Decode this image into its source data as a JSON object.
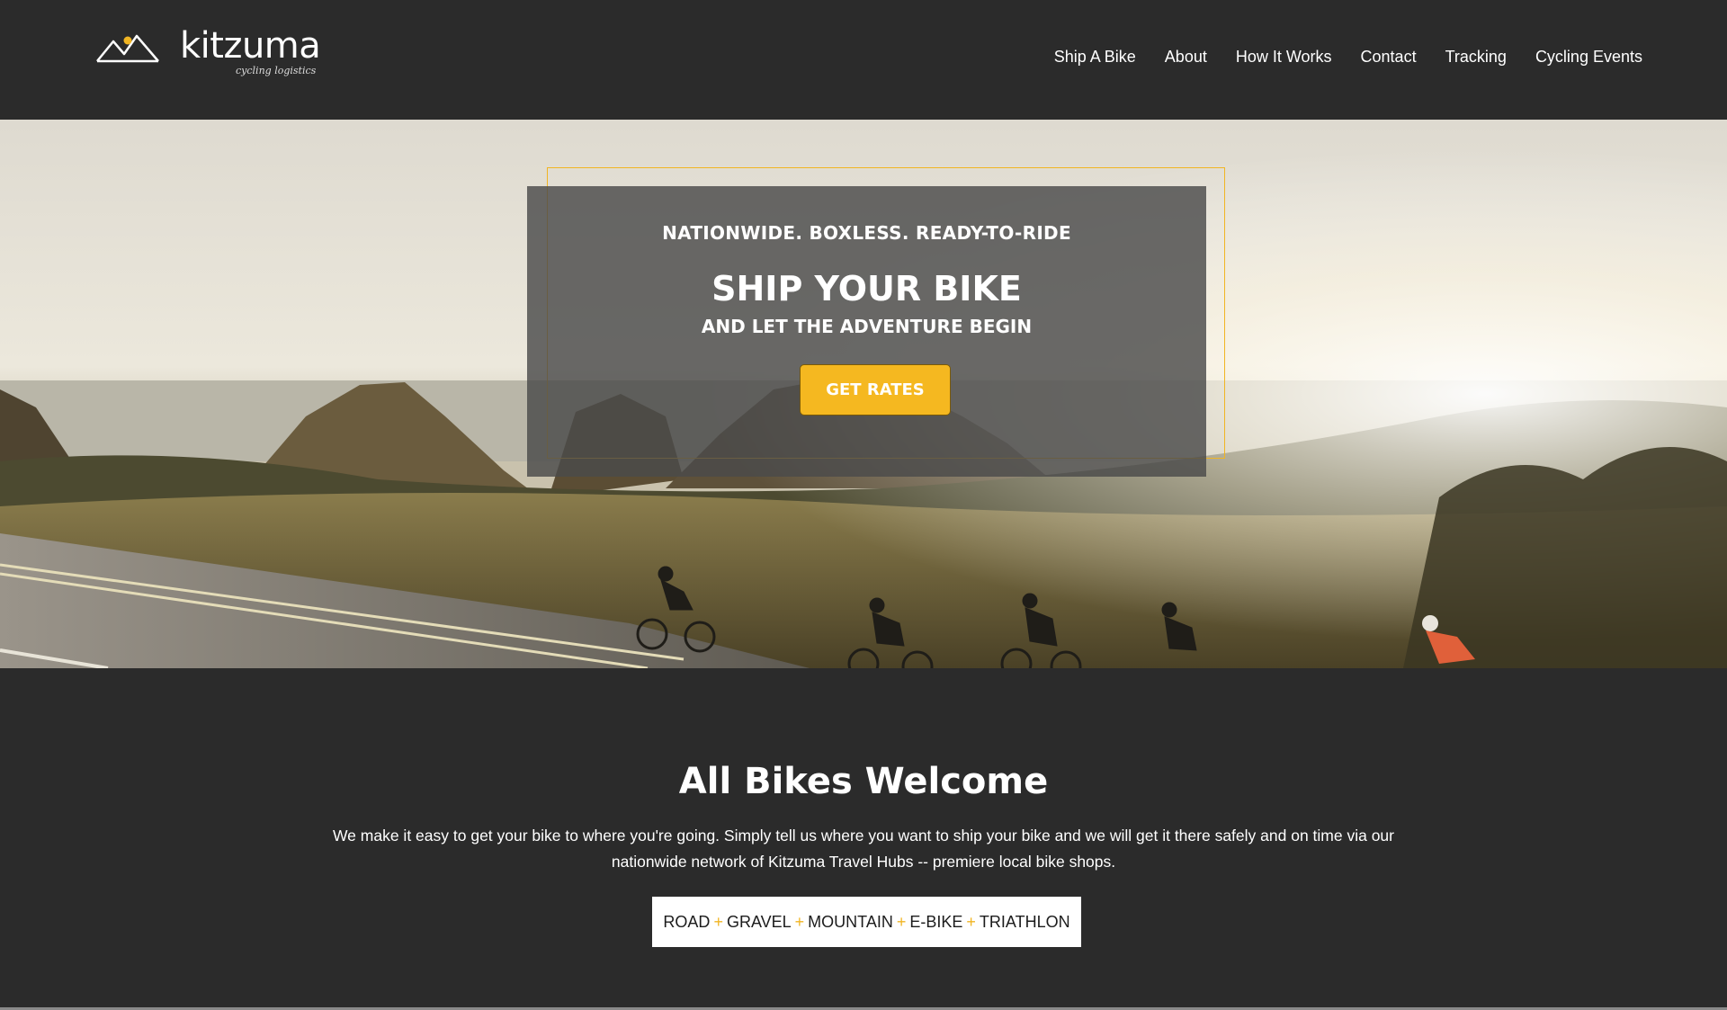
{
  "header": {
    "logo_word": "kitzuma",
    "logo_tagline": "cycling logistics",
    "nav": [
      "Ship A Bike",
      "About",
      "How It Works",
      "Contact",
      "Tracking",
      "Cycling Events"
    ]
  },
  "hero": {
    "kicker": "NATIONWIDE. BOXLESS. READY-TO-RIDE",
    "title": "SHIP YOUR BIKE",
    "subtitle": "AND LET THE ADVENTURE BEGIN",
    "cta": "GET RATES"
  },
  "welcome": {
    "title": "All Bikes Welcome",
    "body": "We make it easy to get your bike to where you're going. Simply tell us where you want to ship your bike and we will get it there safely and on time via our nationwide network of Kitzuma Travel Hubs -- premiere local bike shops.",
    "bike_types": [
      "ROAD",
      "GRAVEL",
      "MOUNTAIN",
      "E-BIKE",
      "TRIATHLON"
    ],
    "separator": "+"
  },
  "colors": {
    "accent": "#f5b820",
    "background": "#2b2b2b",
    "overlay": "#4b4b4b"
  }
}
